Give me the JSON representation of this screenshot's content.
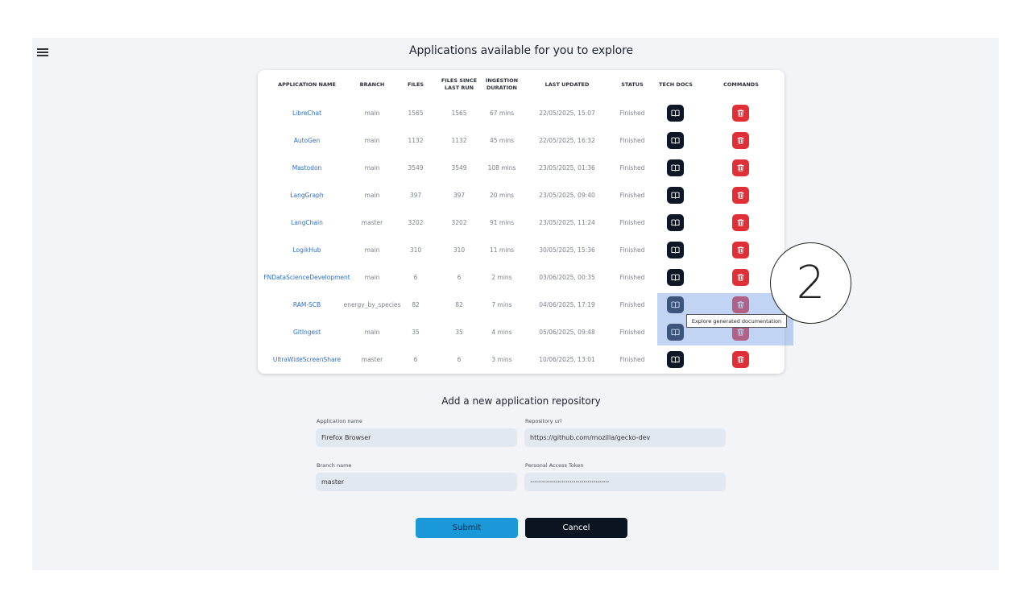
{
  "page": {
    "title": "Applications available for you to explore"
  },
  "table": {
    "headers": {
      "name": "APPLICATION NAME",
      "branch": "BRANCH",
      "files": "FILES",
      "files_since": "FILES SINCE\nLAST RUN",
      "duration": "INGESTION\nDURATION",
      "updated": "LAST UPDATED",
      "status": "STATUS",
      "docs": "TECH DOCS",
      "commands": "COMMANDS"
    },
    "rows": [
      {
        "name": "LibreChat",
        "branch": "main",
        "files": "1565",
        "files_since": "1565",
        "duration": "67 mins",
        "updated": "22/05/2025, 15:07",
        "status": "Finished"
      },
      {
        "name": "AutoGen",
        "branch": "main",
        "files": "1132",
        "files_since": "1132",
        "duration": "45 mins",
        "updated": "22/05/2025, 16:32",
        "status": "Finished"
      },
      {
        "name": "Mastodon",
        "branch": "main",
        "files": "3549",
        "files_since": "3549",
        "duration": "108 mins",
        "updated": "23/05/2025, 01:36",
        "status": "Finished"
      },
      {
        "name": "LangGraph",
        "branch": "main",
        "files": "397",
        "files_since": "397",
        "duration": "20 mins",
        "updated": "23/05/2025, 09:40",
        "status": "Finished"
      },
      {
        "name": "LangChain",
        "branch": "master",
        "files": "3202",
        "files_since": "3202",
        "duration": "91 mins",
        "updated": "23/05/2025, 11:24",
        "status": "Finished"
      },
      {
        "name": "LogikHub",
        "branch": "main",
        "files": "310",
        "files_since": "310",
        "duration": "11 mins",
        "updated": "30/05/2025, 15:36",
        "status": "Finished"
      },
      {
        "name": "FNDataScienceDevelopment",
        "branch": "main",
        "files": "6",
        "files_since": "6",
        "duration": "2 mins",
        "updated": "03/06/2025, 00:35",
        "status": "Finished"
      },
      {
        "name": "RAM-SCB",
        "branch": "energy_by_species",
        "files": "82",
        "files_since": "82",
        "duration": "7 mins",
        "updated": "04/06/2025, 17:19",
        "status": "Finished"
      },
      {
        "name": "GitIngest",
        "branch": "main",
        "files": "35",
        "files_since": "35",
        "duration": "4 mins",
        "updated": "05/06/2025, 09:48",
        "status": "Finished"
      },
      {
        "name": "UltraWideScreenShare",
        "branch": "master",
        "files": "6",
        "files_since": "6",
        "duration": "3 mins",
        "updated": "10/06/2025, 13:01",
        "status": "Finished"
      }
    ]
  },
  "tooltip": "Explore generated documentation",
  "step_marker": "2",
  "form": {
    "title": "Add a new application repository",
    "app_name_label": "Application name",
    "app_name_value": "Firefox Browser",
    "repo_url_label": "Repository url",
    "repo_url_value": "https://github.com/mozilla/gecko-dev",
    "branch_label": "Branch name",
    "branch_value": "master",
    "token_label": "Personal Access Token",
    "token_value": "••••••••••••••••••••••••••••••••••••••••",
    "submit_label": "Submit",
    "cancel_label": "Cancel"
  },
  "icons": {
    "menu": "hamburger-icon",
    "docs": "book-icon",
    "delete": "trash-icon"
  },
  "colors": {
    "docs_button": "#0d1726",
    "delete_button": "#e02f37",
    "submit": "#1b98d8",
    "cancel": "#0b1522",
    "link": "#2e6fc7"
  }
}
